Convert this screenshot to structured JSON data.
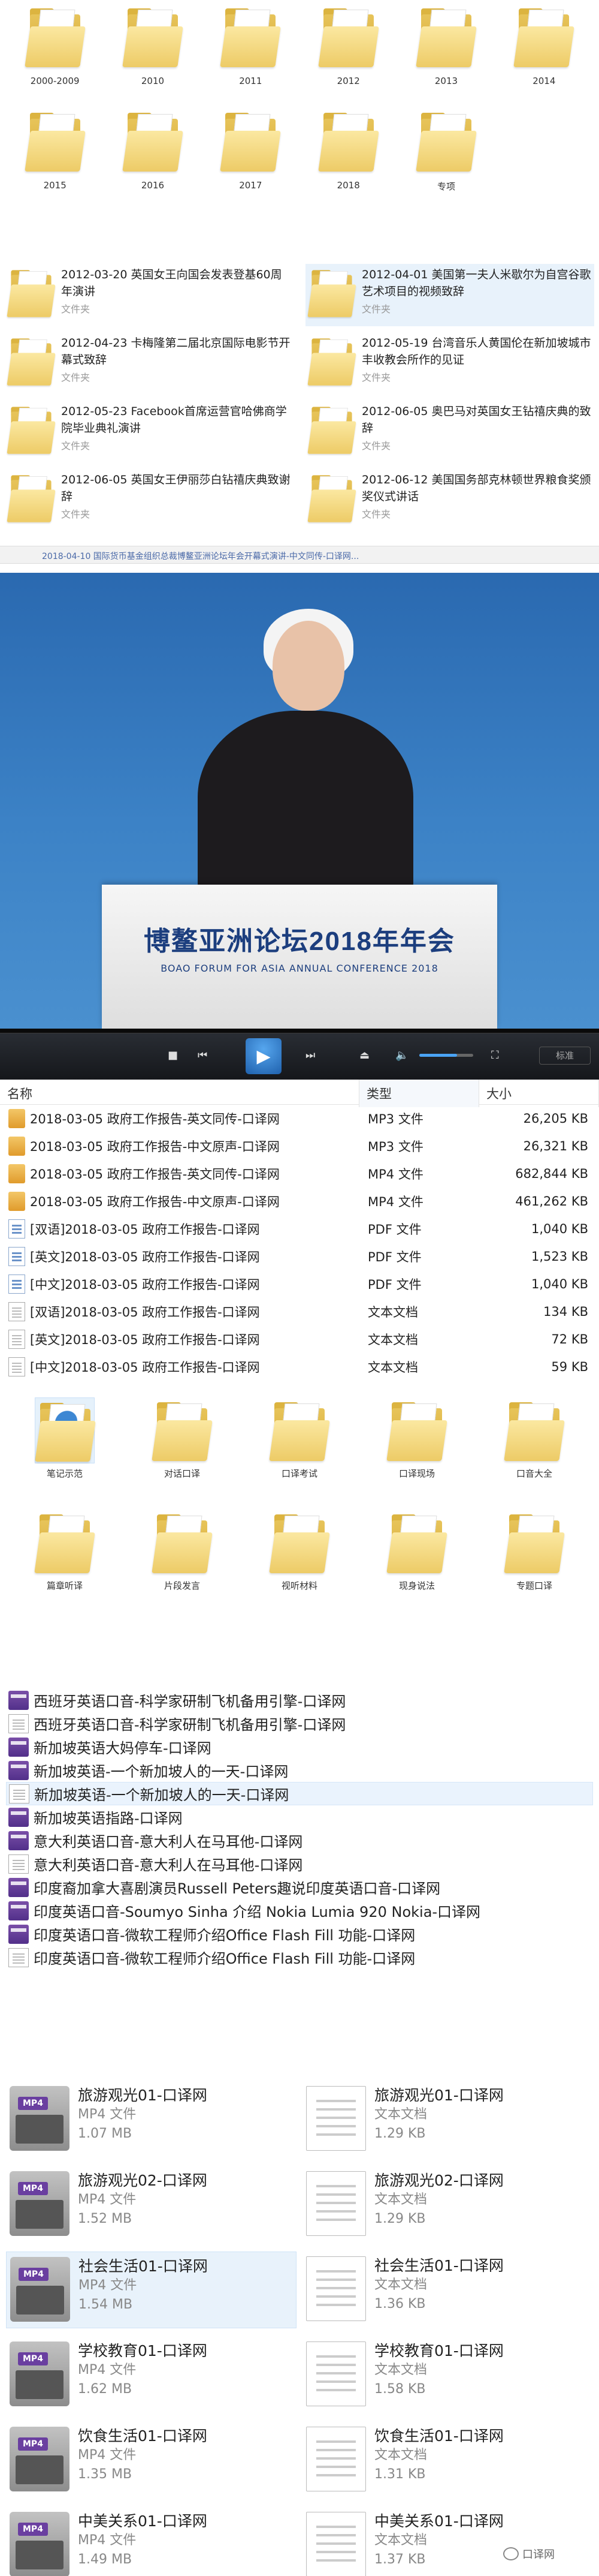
{
  "year_folders": [
    "2000-2009",
    "2010",
    "2011",
    "2012",
    "2013",
    "2014",
    "2015",
    "2016",
    "2017",
    "2018",
    "专项"
  ],
  "speeches": [
    {
      "title": "2012-03-20 英国女王向国会发表登基60周年演讲",
      "subtitle": "文件夹"
    },
    {
      "title": "2012-04-01 美国第一夫人米歇尔为自宫谷歌艺术项目的视频致辞",
      "subtitle": "文件夹"
    },
    {
      "title": "2012-04-23 卡梅隆第二届北京国际电影节开幕式致辞",
      "subtitle": "文件夹"
    },
    {
      "title": "2012-05-19 台湾音乐人黄国伦在新加坡城市丰收教会所作的见证",
      "subtitle": "文件夹"
    },
    {
      "title": "2012-05-23 Facebook首席运营官哈佛商学院毕业典礼演讲",
      "subtitle": "文件夹"
    },
    {
      "title": "2012-06-05 奥巴马对英国女王钻禧庆典的致辞",
      "subtitle": "文件夹"
    },
    {
      "title": "2012-06-05 英国女王伊丽莎白钻禧庆典致谢辞",
      "subtitle": "文件夹"
    },
    {
      "title": "2012-06-12 美国国务部克林顿世界粮食奖颁奖仪式讲话",
      "subtitle": "文件夹"
    }
  ],
  "video_caption": "2018-04-10 国际货币基金组织总裁博鳌亚洲论坛年会开幕式演讲-中文同传-口译网...",
  "podium": {
    "title": "博鳌亚洲论坛2018年年会",
    "subtitle": "BOAO FORUM FOR ASIA ANNUAL CONFERENCE 2018"
  },
  "player": {
    "play_icon": "▶",
    "switch_label": "标准"
  },
  "explorer": {
    "columns": {
      "name": "名称",
      "type": "类型",
      "size": "大小"
    },
    "rows": [
      {
        "name": "2018-03-05 政府工作报告-英文同传-口译网",
        "type": "MP3 文件",
        "size": "26,205 KB",
        "icon": "media"
      },
      {
        "name": "2018-03-05 政府工作报告-中文原声-口译网",
        "type": "MP3 文件",
        "size": "26,321 KB",
        "icon": "media"
      },
      {
        "name": "2018-03-05 政府工作报告-英文同传-口译网",
        "type": "MP4 文件",
        "size": "682,844 KB",
        "icon": "media"
      },
      {
        "name": "2018-03-05 政府工作报告-中文原声-口译网",
        "type": "MP4 文件",
        "size": "461,262 KB",
        "icon": "media"
      },
      {
        "name": "[双语]2018-03-05 政府工作报告-口译网",
        "type": "PDF 文件",
        "size": "1,040 KB",
        "icon": "pdf"
      },
      {
        "name": "[英文]2018-03-05 政府工作报告-口译网",
        "type": "PDF 文件",
        "size": "1,523 KB",
        "icon": "pdf"
      },
      {
        "name": "[中文]2018-03-05 政府工作报告-口译网",
        "type": "PDF 文件",
        "size": "1,040 KB",
        "icon": "pdf"
      },
      {
        "name": "[双语]2018-03-05 政府工作报告-口译网",
        "type": "文本文档",
        "size": "134 KB",
        "icon": "txt"
      },
      {
        "name": "[英文]2018-03-05 政府工作报告-口译网",
        "type": "文本文档",
        "size": "72 KB",
        "icon": "txt"
      },
      {
        "name": "[中文]2018-03-05 政府工作报告-口译网",
        "type": "文本文档",
        "size": "59 KB",
        "icon": "txt"
      }
    ]
  },
  "categories": [
    "笔记示范",
    "对话口译",
    "口译考试",
    "口译现场",
    "口音大全",
    "篇章听译",
    "片段发言",
    "视听材料",
    "现身说法",
    "专题口译"
  ],
  "accent_list": [
    {
      "label": "西班牙英语口音-科学家研制飞机备用引擎-口译网",
      "icon": "vid"
    },
    {
      "label": "西班牙英语口音-科学家研制飞机备用引擎-口译网",
      "icon": "doc"
    },
    {
      "label": "新加坡英语大妈停车-口译网",
      "icon": "vid"
    },
    {
      "label": "新加坡英语-一个新加坡人的一天-口译网",
      "icon": "vid"
    },
    {
      "label": "新加坡英语-一个新加坡人的一天-口译网",
      "icon": "doc"
    },
    {
      "label": "新加坡英语指路-口译网",
      "icon": "vid"
    },
    {
      "label": "意大利英语口音-意大利人在马耳他-口译网",
      "icon": "vid"
    },
    {
      "label": "意大利英语口音-意大利人在马耳他-口译网",
      "icon": "doc"
    },
    {
      "label": "印度裔加拿大喜剧演员Russell Peters趣说印度英语口音-口译网",
      "icon": "vid"
    },
    {
      "label": "印度英语口音-Soumyo Sinha 介绍 Nokia Lumia 920 Nokia-口译网",
      "icon": "vid"
    },
    {
      "label": "印度英语口音-微软工程师介绍Office Flash Fill 功能-口译网",
      "icon": "vid"
    },
    {
      "label": "印度英语口音-微软工程师介绍Office Flash Fill 功能-口译网",
      "icon": "doc"
    }
  ],
  "tiles": [
    {
      "name": "旅游观光01-口译网",
      "type": "MP4 文件",
      "size": "1.07 MB",
      "icon": "mp4"
    },
    {
      "name": "旅游观光01-口译网",
      "type": "文本文档",
      "size": "1.29 KB",
      "icon": "txt"
    },
    {
      "name": "旅游观光02-口译网",
      "type": "MP4 文件",
      "size": "1.52 MB",
      "icon": "mp4"
    },
    {
      "name": "旅游观光02-口译网",
      "type": "文本文档",
      "size": "1.29 KB",
      "icon": "txt"
    },
    {
      "name": "社会生活01-口译网",
      "type": "MP4 文件",
      "size": "1.54 MB",
      "icon": "mp4"
    },
    {
      "name": "社会生活01-口译网",
      "type": "文本文档",
      "size": "1.36 KB",
      "icon": "txt"
    },
    {
      "name": "学校教育01-口译网",
      "type": "MP4 文件",
      "size": "1.62 MB",
      "icon": "mp4"
    },
    {
      "name": "学校教育01-口译网",
      "type": "文本文档",
      "size": "1.58 KB",
      "icon": "txt"
    },
    {
      "name": "饮食生活01-口译网",
      "type": "MP4 文件",
      "size": "1.35 MB",
      "icon": "mp4"
    },
    {
      "name": "饮食生活01-口译网",
      "type": "文本文档",
      "size": "1.31 KB",
      "icon": "txt"
    },
    {
      "name": "中美关系01-口译网",
      "type": "MP4 文件",
      "size": "1.49 MB",
      "icon": "mp4"
    },
    {
      "name": "中美关系01-口译网",
      "type": "文本文档",
      "size": "1.37 KB",
      "icon": "txt"
    }
  ],
  "mp4_badge": "MP4",
  "watermark": "口译网"
}
